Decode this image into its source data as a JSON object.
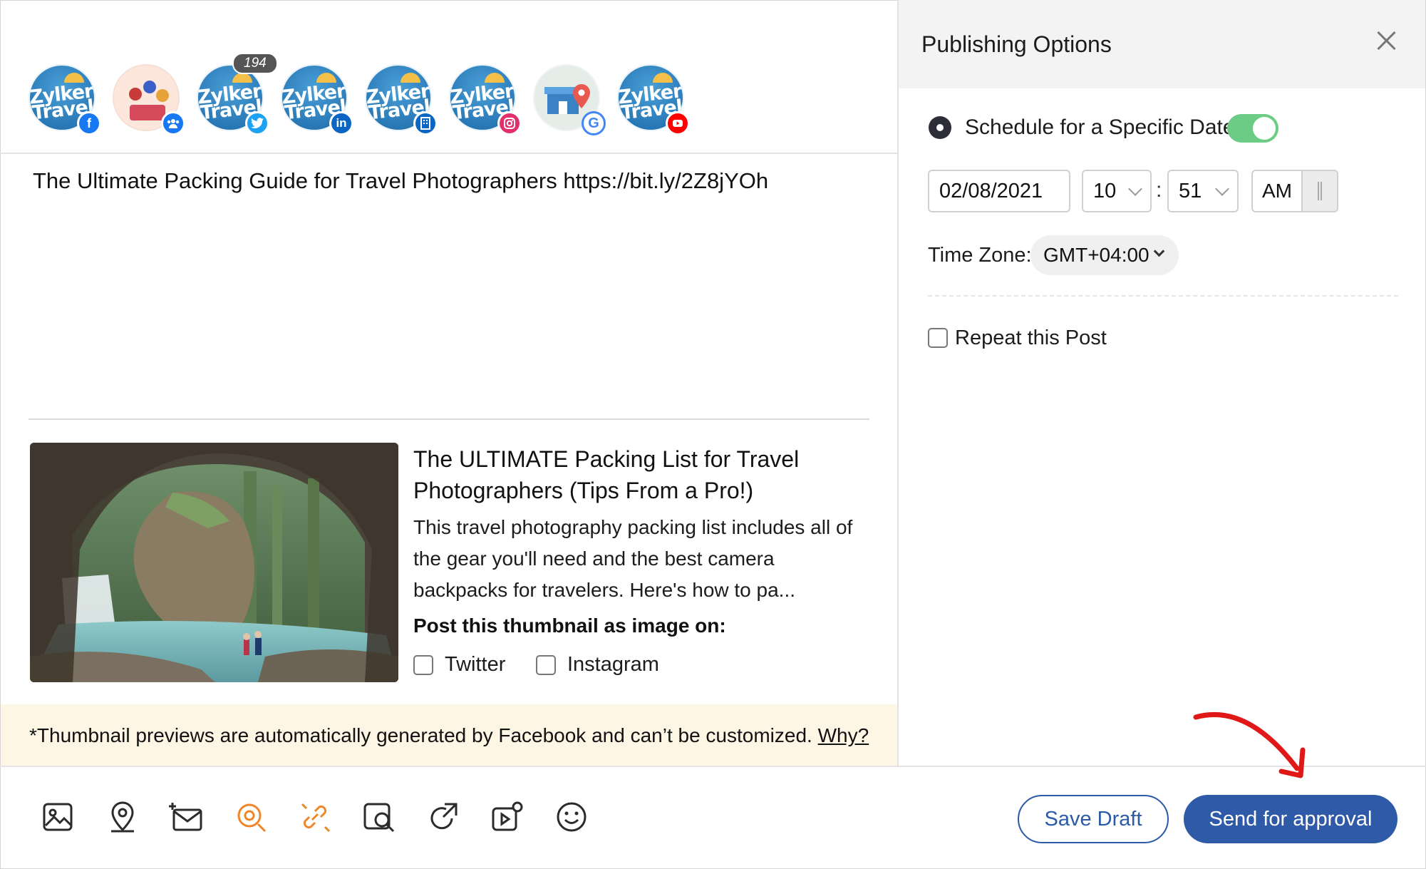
{
  "accounts": [
    {
      "name": "zylker-facebook",
      "badge": "f",
      "badge_color": "#1877f2"
    },
    {
      "name": "group",
      "badge": "group",
      "badge_color": "#1877f2"
    },
    {
      "name": "zylker-twitter",
      "badge": "t",
      "badge_color": "#1da1f2",
      "count": "194"
    },
    {
      "name": "zylker-linkedin",
      "badge": "in",
      "badge_color": "#0a66c2"
    },
    {
      "name": "zylker-linkedin-page",
      "badge": "page",
      "badge_color": "#0a66c2"
    },
    {
      "name": "zylker-instagram",
      "badge": "ig",
      "badge_color": "#e1306c"
    },
    {
      "name": "google-my-business",
      "badge": "G",
      "badge_color": "#4285f4"
    },
    {
      "name": "zylker-youtube",
      "badge": "yt",
      "badge_color": "#ff0000"
    }
  ],
  "brand": {
    "line1": "Zylker",
    "line2": "Travel"
  },
  "composer": {
    "post_text": "The Ultimate Packing Guide for Travel Photographers https://bit.ly/2Z8jYOh",
    "preview_title": "The ULTIMATE Packing List for Travel Photographers (Tips From a Pro!)",
    "preview_description": "This travel photography packing list includes all of the gear you'll need and the best camera backpacks for travelers. Here's how to pa...",
    "thumbnail_label": "Post this thumbnail as image on:",
    "thumb_options": [
      "Twitter",
      "Instagram"
    ],
    "notice": "*Thumbnail previews are automatically generated by Facebook and can’t be customized.",
    "notice_link": "Why?"
  },
  "panel": {
    "title": "Publishing Options",
    "schedule_label": "Schedule for a Specific Date",
    "date": "02/08/2021",
    "hour": "10",
    "minute": "51",
    "colon": ":",
    "ampm": "AM",
    "timezone_label": "Time Zone:",
    "timezone": "GMT+04:00",
    "repeat_label": "Repeat this Post"
  },
  "footer": {
    "tools": [
      "image-icon",
      "location-icon",
      "email-icon",
      "mention-icon",
      "link-icon",
      "image-search-icon",
      "share-icon",
      "video-settings-icon",
      "emoji-icon"
    ],
    "save_draft": "Save Draft",
    "send": "Send for approval"
  },
  "colors": {
    "accent": "#2f5aa8",
    "toggle_on": "#6ccb84",
    "orange_icon": "#f0862a",
    "notice_bg": "#fdf6e4"
  }
}
